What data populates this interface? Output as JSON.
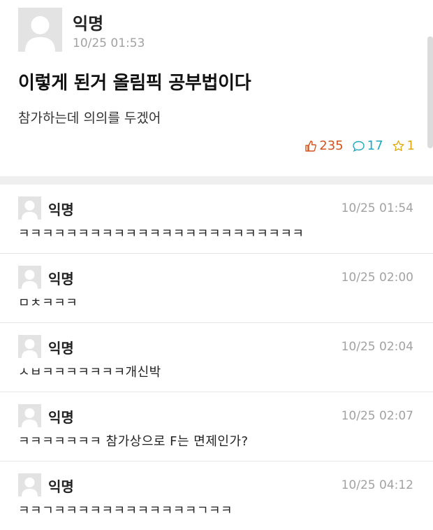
{
  "post": {
    "author": "익명",
    "date": "10/25 01:53",
    "title": "이렇게 된거 올림픽 공부법이다",
    "body": "참가하는데 의의를 두겠어",
    "stats": {
      "likes": "235",
      "comments": "17",
      "scraps": "1"
    }
  },
  "icons": {
    "like": "thumbs-up-icon",
    "comment": "speech-bubble-icon",
    "scrap": "star-icon",
    "avatar": "default-avatar-icon"
  },
  "colors": {
    "likes": "#d2541f",
    "comments": "#22a7c2",
    "scraps": "#e0a912",
    "separator": "#efefef"
  },
  "comments": [
    {
      "author": "익명",
      "time": "10/25 01:54",
      "text": "ㅋㅋㅋㅋㅋㅋㅋㅋㅋㅋㅋㅋㅋㅋㅋㅋㅋㅋㅋㅋㅋㅋㅋㅋ"
    },
    {
      "author": "익명",
      "time": "10/25 02:00",
      "text": "ㅁㅊㅋㅋㅋ"
    },
    {
      "author": "익명",
      "time": "10/25 02:04",
      "text": "ㅅㅂㅋㅋㅋㅋㅋㅋㅋ개신박"
    },
    {
      "author": "익명",
      "time": "10/25 02:07",
      "text": "ㅋㅋㅋㅋㅋㅋㅋ 참가상으로 F는 면제인가?"
    },
    {
      "author": "익명",
      "time": "10/25 04:12",
      "text": "ㅋㅋㄱㅋㅋㅋㅋㅋㅋㅋㅋㅋㅋㅋㅋㄱㅋㅋ"
    }
  ]
}
